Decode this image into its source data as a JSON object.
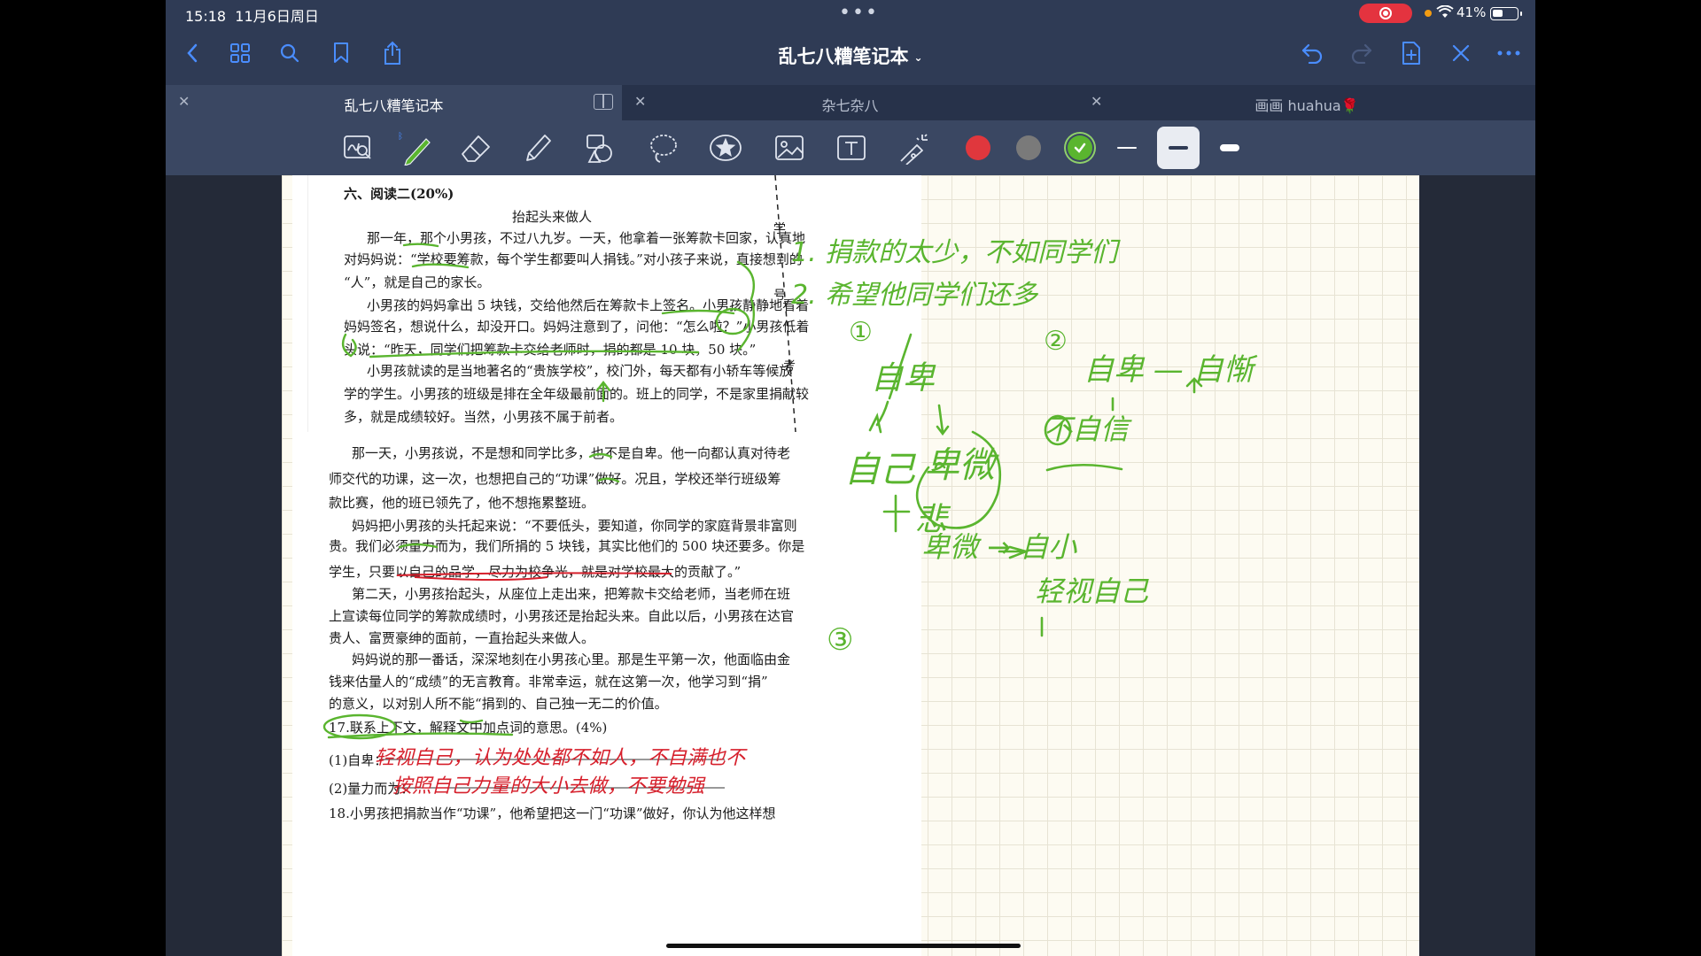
{
  "status_bar": {
    "time": "15:18",
    "date": "11月6日周日",
    "battery": "41%",
    "battery_fraction": 0.41
  },
  "nav": {
    "title": "乱七八糟笔记本",
    "icons": [
      "back-icon",
      "grid-icon",
      "search-icon",
      "bookmark-icon",
      "share-icon",
      "undo-icon",
      "redo-icon",
      "add-page-icon",
      "close-icon",
      "more-icon"
    ]
  },
  "tabs": [
    {
      "label": "乱七八糟笔记本",
      "active": true
    },
    {
      "label": "杂七杂八",
      "active": false
    },
    {
      "label": "画画 huahua🌹",
      "active": false
    }
  ],
  "toolbar": {
    "tools": [
      "zoom-lasso-icon",
      "pen-icon",
      "eraser-icon",
      "highlighter-icon",
      "shapes-icon",
      "lasso-icon",
      "sticker-icon",
      "image-icon",
      "text-icon",
      "laser-pointer-icon"
    ],
    "colors": [
      "#e0373d",
      "#7a7a7a",
      "#5ab52f"
    ],
    "selected_color": "#5ab52f",
    "stroke_widths": [
      "thin",
      "medium",
      "thick"
    ],
    "selected_width": "medium"
  },
  "document": {
    "heading": "六、阅读二(20%)",
    "story_title": "抬起头来做人",
    "lines": [
      "那一年，那个小男孩，不过八九岁。一天，他拿着一张筹款卡回家，认真地",
      "对妈妈说：“学校要筹款，每个学生都要叫人捐钱。”对小孩子来说，直接想到的",
      "“人”，就是自己的家长。",
      "小男孩的妈妈拿出 5 块钱，交给他然后在筹款卡上签名。小男孩静静地看着",
      "妈妈签名，想说什么，却没开口。妈妈注意到了，问他：“怎么啦？”小男孩低着",
      "头说：“昨天，同学们把筹款卡交给老师时，捐的都是 10 块，50 块。”",
      "小男孩就读的是当地著名的“贵族学校”，校门外，每天都有小轿车等候放",
      "学的学生。小男孩的班级是排在全年级最前面的。班上的同学，不是家里捐献较",
      "多，就是成绩较好。当然，小男孩不属于前者。",
      "那一天，小男孩说，不是想和同学比多，也不是自卑。他一向都认真对待老",
      "师交代的功课，这一次，也想把自己的“功课”做好。况且，学校还举行班级筹",
      "款比赛，他的班已领先了，他不想拖累整班。",
      "妈妈把小男孩的头托起来说：“不要低头，要知道，你同学的家庭背景非富则",
      "贵。我们必须量力而为，我们所捐的 5 块钱，其实比他们的 500 块还要多。你是",
      "学生，只要以自己的品学，尽力为校争光，就是对学校最大的贡献了。”",
      "第二天，小男孩抬起头，从座位上走出来，把筹款卡交给老师，当老师在班",
      "上宣读每位同学的筹款成绩时，小男孩还是抬起头来。自此以后，小男孩在达官",
      "贵人、富贾豪绅的面前，一直抬起头来做人。",
      "妈妈说的那一番话，深深地刻在小男孩心里。那是生平第一次，他面临由金",
      "钱来估量人的“成绩”的无言教育。非常幸运，就在这第一次，他学习到“捐”",
      "的意义，以对别人所不能“捐到的、自己独一无二的价值。",
      "17.联系上下文，解释文中加点词的意思。(4%)",
      "(1)自卑：",
      "(2)量力而为：",
      "18.小男孩把捐款当作“功课”，他希望把这一门“功课”做好，你认为他这样想"
    ],
    "side_marks": [
      "学",
      "号",
      "考"
    ]
  },
  "red_answers": [
    "轻视自己，认为处处都不如人，不自满也不",
    "按照自己力量的大小去做，不要勉强"
  ],
  "green_notes": [
    "1. 捐款的太少，不如同学们",
    "2. 希望他同学们还多",
    "①",
    "自卑",
    "自己",
    "卑微",
    "悲",
    "②",
    "自卑 — 自惭",
    "不自信",
    "卑微 → 自小",
    "轻视自己",
    "③"
  ]
}
